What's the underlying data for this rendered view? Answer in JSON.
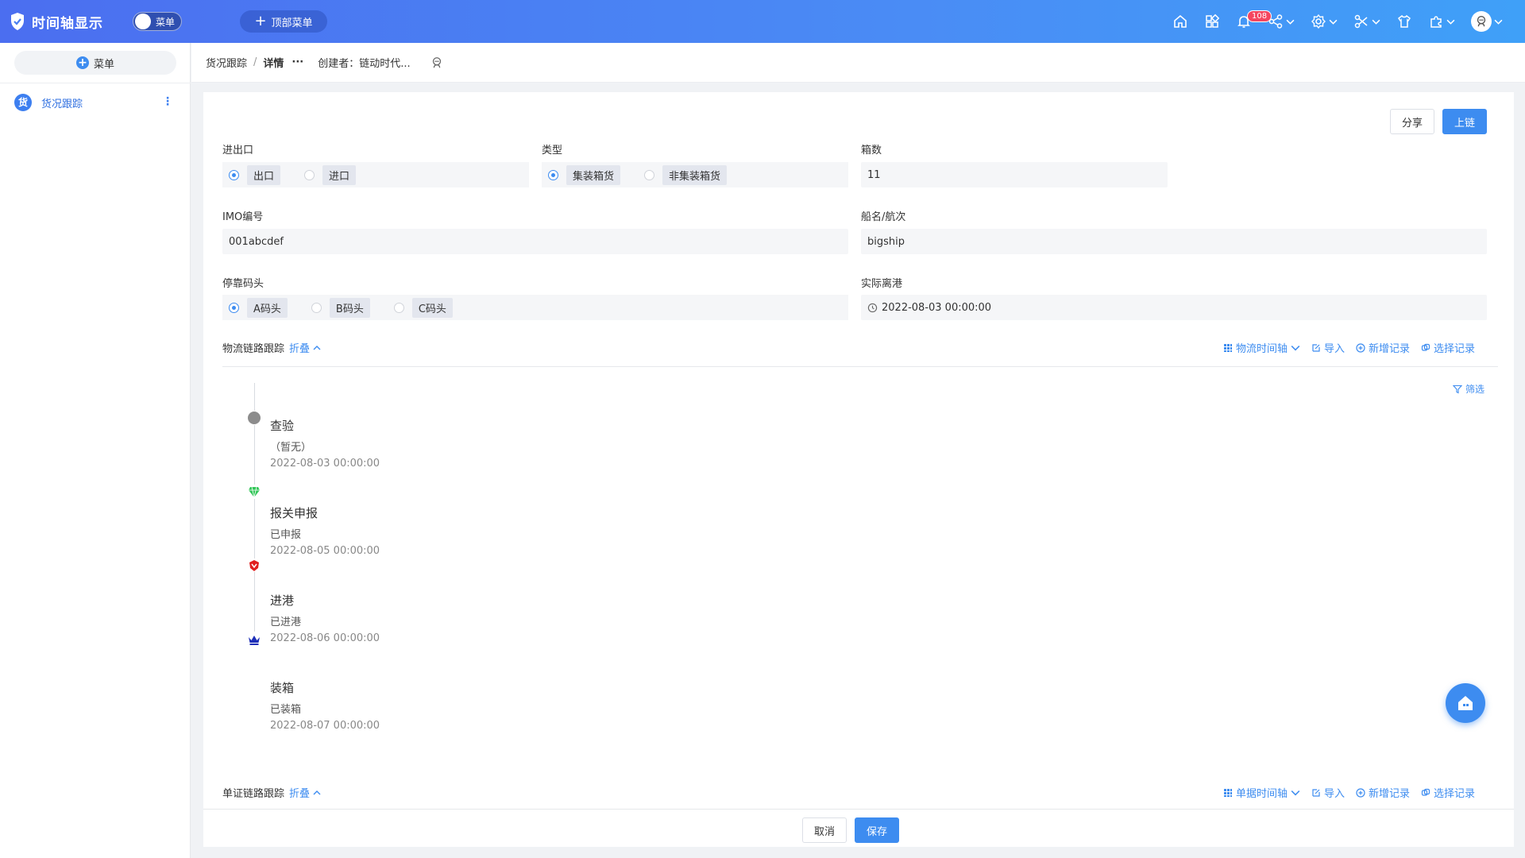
{
  "app": {
    "title": "时间轴显示",
    "menu_toggle_label": "菜单",
    "top_menu_label": "顶部菜单"
  },
  "header": {
    "notification_count": "108"
  },
  "sidebar": {
    "menu_button_label": "菜单",
    "items": [
      {
        "badge": "货",
        "label": "货况跟踪"
      }
    ]
  },
  "breadcrumb": {
    "parent": "货况跟踪",
    "separator": "/",
    "current": "详情",
    "more": "···",
    "creator": "创建者：链动时代..."
  },
  "actions": {
    "share": "分享",
    "chain": "上链",
    "cancel": "取消",
    "save": "保存"
  },
  "form": {
    "direction": {
      "label": "进出口",
      "options": [
        "出口",
        "进口"
      ],
      "selected": "出口"
    },
    "type": {
      "label": "类型",
      "options": [
        "集装箱货",
        "非集装箱货"
      ],
      "selected": "集装箱货"
    },
    "box_count": {
      "label": "箱数",
      "value": "11"
    },
    "imo": {
      "label": "IMO编号",
      "value": "001abcdef"
    },
    "vessel": {
      "label": "船名/航次",
      "value": "bigship"
    },
    "berth": {
      "label": "停靠码头",
      "options": [
        "A码头",
        "B码头",
        "C码头"
      ],
      "selected": "A码头"
    },
    "departure": {
      "label": "实际离港",
      "value": "2022-08-03 00:00:00"
    }
  },
  "logistics": {
    "title": "物流链路跟踪",
    "fold": "折叠",
    "actions": {
      "view": "物流时间轴",
      "import": "导入",
      "add": "新增记录",
      "select": "选择记录"
    },
    "filter": "筛选",
    "events": [
      {
        "title": "查验",
        "status": "（暂无）",
        "time": "2022-08-03 00:00:00",
        "icon": "grey-dot-icon"
      },
      {
        "title": "报关申报",
        "status": "已申报",
        "time": "2022-08-05 00:00:00",
        "icon": "green-diamond-icon"
      },
      {
        "title": "进港",
        "status": "已进港",
        "time": "2022-08-06 00:00:00",
        "icon": "red-badge-icon"
      },
      {
        "title": "装箱",
        "status": "已装箱",
        "time": "2022-08-07 00:00:00",
        "icon": "crown-icon"
      }
    ]
  },
  "documents": {
    "title": "单证链路跟踪",
    "fold": "折叠",
    "actions": {
      "view": "单据时间轴",
      "import": "导入",
      "add": "新增记录",
      "select": "选择记录"
    }
  },
  "colors": {
    "primary": "#3d8cf0",
    "header_start": "#4b6ef0",
    "header_end": "#3fa0f8",
    "badge": "#f5465f"
  }
}
